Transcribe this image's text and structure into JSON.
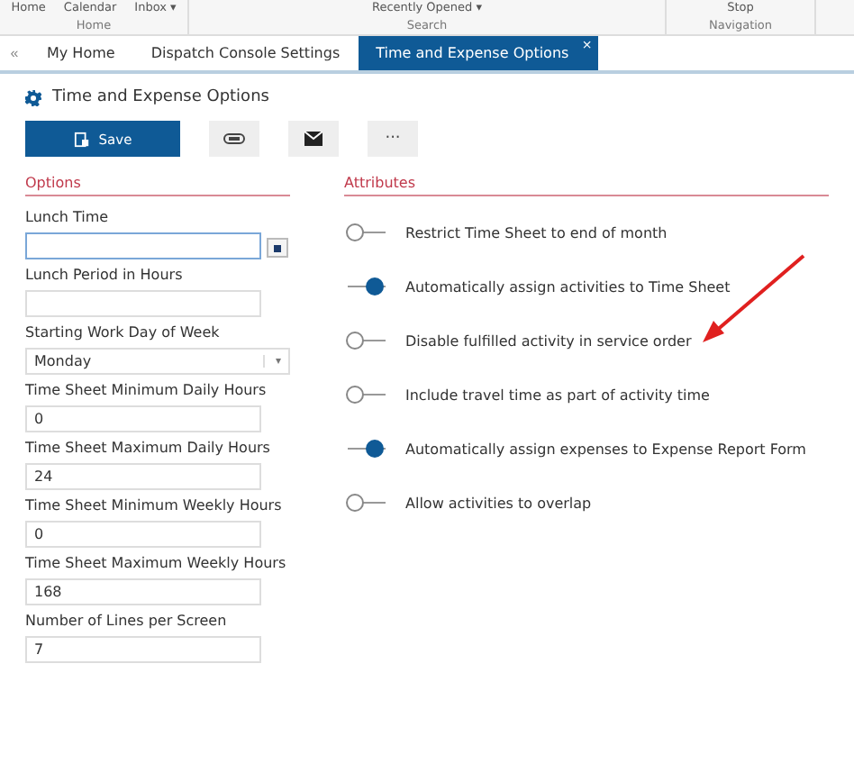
{
  "ribbon": {
    "groups": [
      {
        "label": "Home",
        "items": [
          "Home",
          "Calendar",
          "Inbox ▾"
        ]
      },
      {
        "label": "Search",
        "items": [
          "Recently Opened ▾"
        ]
      },
      {
        "label": "Navigation",
        "items": [
          "Stop"
        ]
      }
    ]
  },
  "tabs": [
    {
      "label": "My Home",
      "selected": false
    },
    {
      "label": "Dispatch Console Settings",
      "selected": false
    },
    {
      "label": "Time and Expense Options",
      "selected": true,
      "close": "×"
    }
  ],
  "collapse": "«",
  "page": {
    "title": "Time and Expense Options"
  },
  "toolbar": {
    "save": "Save",
    "more": "···"
  },
  "options": {
    "heading": "Options",
    "fields": [
      {
        "kind": "time",
        "label": "Lunch Time",
        "focused": true
      },
      {
        "kind": "text",
        "label": "Lunch Period in Hours"
      },
      {
        "kind": "select",
        "label": "Starting Work Day of Week",
        "value": "Monday",
        "caret": "▾"
      },
      {
        "kind": "text",
        "label": "Time Sheet Minimum Daily Hours",
        "value": "0"
      },
      {
        "kind": "text",
        "label": "Time Sheet Maximum Daily Hours",
        "value": "24"
      },
      {
        "kind": "text",
        "label": "Time Sheet Minimum Weekly Hours",
        "value": "0"
      },
      {
        "kind": "text",
        "label": "Time Sheet Maximum Weekly Hours",
        "value": "168"
      },
      {
        "kind": "text",
        "label": "Number of Lines per Screen",
        "value": "7"
      }
    ]
  },
  "attributes": {
    "heading": "Attributes",
    "items": [
      {
        "label": "Restrict Time Sheet to end of month",
        "on": false
      },
      {
        "label": "Automatically assign activities to Time Sheet",
        "on": true
      },
      {
        "label": "Disable fulfilled activity in service order",
        "on": false
      },
      {
        "label": "Include travel time as part of activity time",
        "on": false
      },
      {
        "label": "Automatically assign expenses to Expense Report Form",
        "on": true
      },
      {
        "label": "Allow activities to overlap",
        "on": false
      }
    ]
  }
}
